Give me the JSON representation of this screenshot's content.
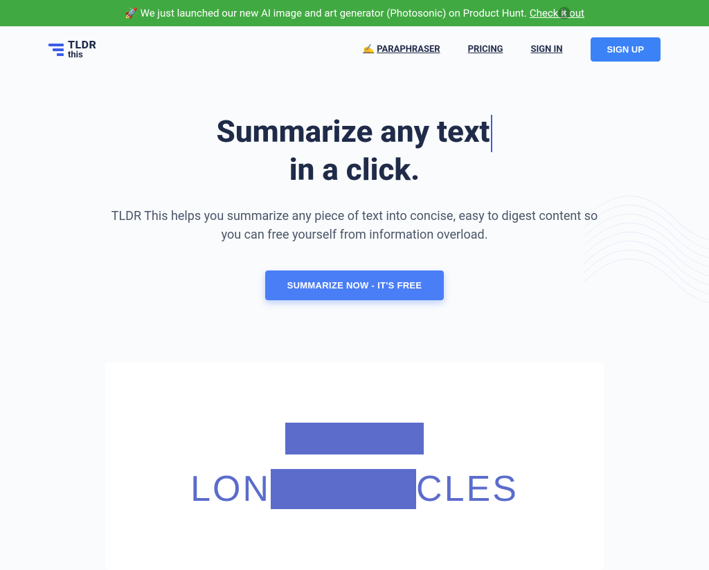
{
  "announcement": {
    "icon": "🚀",
    "text": "We just launched our new AI image and art generator (Photosonic) on Product Hunt. ",
    "link_text": "Check it out"
  },
  "logo": {
    "tldr": "TLDR",
    "this": "this"
  },
  "nav": {
    "paraphraser_icon": "✍️",
    "paraphraser": "PARAPHRASER",
    "pricing": "PRICING",
    "signin": "SIGN IN",
    "signup": "SIGN UP"
  },
  "hero": {
    "title_line1": "Summarize any text",
    "title_line2": "in a click.",
    "subtitle": "TLDR This helps you summarize any piece of text into concise, easy to digest content so you can free yourself from information overload.",
    "cta": "SUMMARIZE NOW - IT'S FREE"
  },
  "demo": {
    "text_left": "LON",
    "text_right": "CLES"
  }
}
